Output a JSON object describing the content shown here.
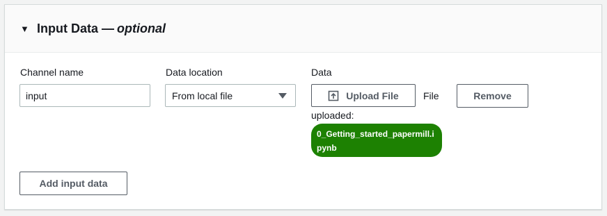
{
  "section": {
    "title": "Input Data —",
    "title_suffix": "optional"
  },
  "channel": {
    "label": "Channel name",
    "value": "input"
  },
  "data_location": {
    "label": "Data location",
    "selected": "From local file"
  },
  "data": {
    "label": "Data",
    "upload_label": "Upload File",
    "file_status_label": "File",
    "uploaded_label": "uploaded:",
    "remove_label": "Remove",
    "uploaded_file_name": "0_Getting_started_papermill.ipynb"
  },
  "actions": {
    "add_input_label": "Add input data"
  },
  "icons": {
    "caret": "caret-down-icon",
    "upload": "upload-icon",
    "dropdown": "dropdown-arrow-icon"
  },
  "colors": {
    "success": "#1d8102",
    "border": "#aab7b8",
    "button_text": "#545b64"
  }
}
